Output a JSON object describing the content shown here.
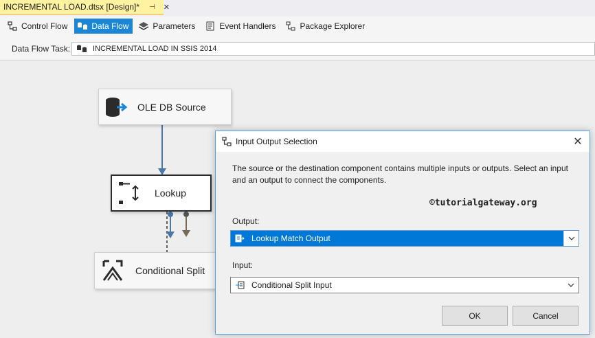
{
  "document_tab": {
    "title": "INCREMENTAL LOAD.dtsx [Design]*",
    "pin_icon": "pin-icon",
    "close_icon": "close-icon",
    "color": "#fff2a0"
  },
  "designer_tabs": [
    {
      "label": "Control Flow",
      "icon": "control-flow-icon",
      "active": false
    },
    {
      "label": "Data Flow",
      "icon": "data-flow-icon",
      "active": true
    },
    {
      "label": "Parameters",
      "icon": "parameters-icon",
      "active": false
    },
    {
      "label": "Event Handlers",
      "icon": "event-handlers-icon",
      "active": false
    },
    {
      "label": "Package Explorer",
      "icon": "package-explorer-icon",
      "active": false
    }
  ],
  "task": {
    "label": "Data Flow Task:",
    "value": "INCREMENTAL LOAD IN SSIS 2014",
    "icon": "data-flow-task-icon"
  },
  "canvas": {
    "nodes": [
      {
        "label": "OLE DB Source",
        "icon": "database-source-icon"
      },
      {
        "label": "Lookup",
        "icon": "lookup-icon"
      },
      {
        "label": "Conditional Split",
        "icon": "conditional-split-icon"
      }
    ]
  },
  "dialog": {
    "title": "Input Output Selection",
    "description": "The source or the destination component contains multiple inputs or outputs. Select an input and an output to connect the components.",
    "watermark": "©tutorialgateway.org",
    "output_label": "Output:",
    "output_value": "Lookup Match Output",
    "input_label": "Input:",
    "input_value": "Conditional Split Input",
    "ok_label": "OK",
    "cancel_label": "Cancel"
  },
  "colors": {
    "accent": "#1c86d6",
    "selection": "#0078d7",
    "dialog_border": "#5aa0dc"
  }
}
